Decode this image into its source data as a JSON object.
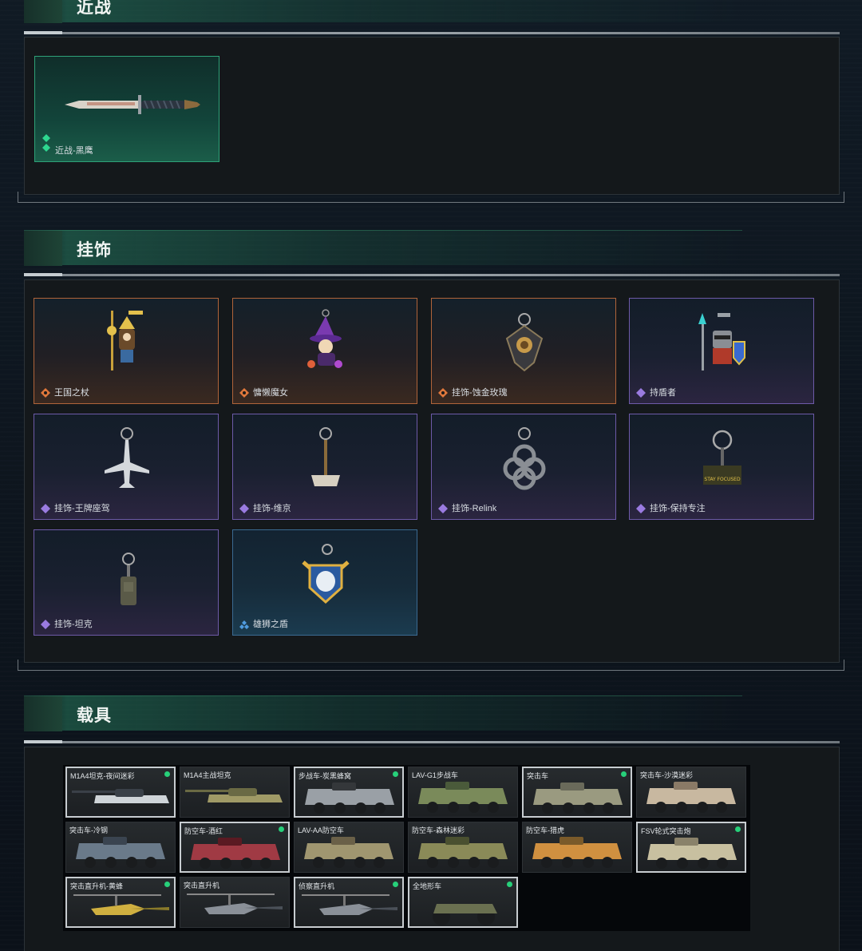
{
  "sections": {
    "melee": {
      "title": "近战"
    },
    "charms": {
      "title": "挂饰"
    },
    "vehicles": {
      "title": "载具"
    }
  },
  "melee_items": [
    {
      "label": "近战-黑鹰",
      "rarity": "green"
    }
  ],
  "charm_items": [
    {
      "label": "王国之杖",
      "rarity": "orange"
    },
    {
      "label": "慵懒魔女",
      "rarity": "orange"
    },
    {
      "label": "挂饰-蚀金玫瑰",
      "rarity": "orange"
    },
    {
      "label": "持盾者",
      "rarity": "purple"
    },
    {
      "label": "挂饰-王牌座驾",
      "rarity": "purple"
    },
    {
      "label": "挂饰-维京",
      "rarity": "purple"
    },
    {
      "label": "挂饰-Relink",
      "rarity": "purple"
    },
    {
      "label": "挂饰-保持专注",
      "rarity": "purple"
    },
    {
      "label": "挂饰-坦克",
      "rarity": "purple"
    },
    {
      "label": "雄狮之盾",
      "rarity": "blue"
    }
  ],
  "charm_extra_text": {
    "stay_focused": "STAY FOCUSED"
  },
  "vehicle_items": [
    {
      "label": "M1A4坦克-夜间迷彩",
      "owned": true
    },
    {
      "label": "M1A4主战坦克",
      "owned": false
    },
    {
      "label": "步战车-炭黑蜂窝",
      "owned": true
    },
    {
      "label": "LAV-G1步战车",
      "owned": false
    },
    {
      "label": "突击车",
      "owned": true
    },
    {
      "label": "突击车-沙漠迷彩",
      "owned": false
    },
    {
      "label": "突击车-冷钢",
      "owned": false
    },
    {
      "label": "防空车-酒红",
      "owned": true
    },
    {
      "label": "LAV-AA防空车",
      "owned": false
    },
    {
      "label": "防空车-森林迷彩",
      "owned": false
    },
    {
      "label": "防空车-猎虎",
      "owned": false
    },
    {
      "label": "FSV轮式突击炮",
      "owned": true
    },
    {
      "label": "突击直升机-黄蜂",
      "owned": true
    },
    {
      "label": "突击直升机",
      "owned": false
    },
    {
      "label": "侦察直升机",
      "owned": true
    },
    {
      "label": "全地形车",
      "owned": true
    }
  ],
  "colors": {
    "green_rarity": "#2ed68f",
    "orange_rarity": "#e0783c",
    "purple_rarity": "#9a7be0",
    "blue_rarity": "#4f9be0",
    "owned_dot": "#27d07a"
  }
}
